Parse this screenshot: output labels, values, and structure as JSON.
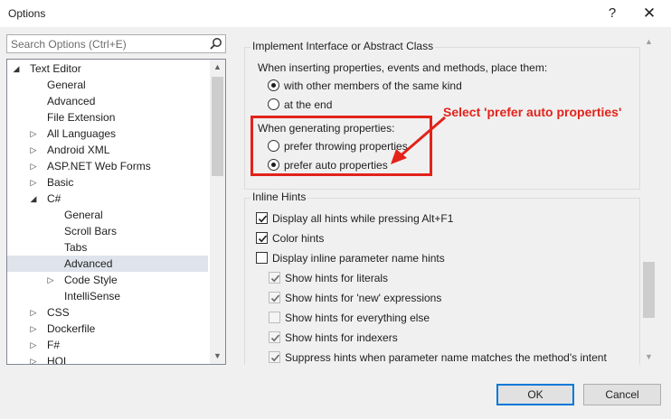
{
  "window": {
    "title": "Options",
    "help_glyph": "?",
    "close_glyph": "✕"
  },
  "search": {
    "placeholder": "Search Options (Ctrl+E)"
  },
  "tree": {
    "items": [
      {
        "label": "Text Editor",
        "caret": "◢"
      },
      {
        "label": "General",
        "caret": ""
      },
      {
        "label": "Advanced",
        "caret": ""
      },
      {
        "label": "File Extension",
        "caret": ""
      },
      {
        "label": "All Languages",
        "caret": "▷"
      },
      {
        "label": "Android XML",
        "caret": "▷"
      },
      {
        "label": "ASP.NET Web Forms",
        "caret": "▷"
      },
      {
        "label": "Basic",
        "caret": "▷"
      },
      {
        "label": "C#",
        "caret": "◢"
      },
      {
        "label": "General",
        "caret": ""
      },
      {
        "label": "Scroll Bars",
        "caret": ""
      },
      {
        "label": "Tabs",
        "caret": ""
      },
      {
        "label": "Advanced",
        "caret": "",
        "selected": true
      },
      {
        "label": "Code Style",
        "caret": "▷"
      },
      {
        "label": "IntelliSense",
        "caret": ""
      },
      {
        "label": "CSS",
        "caret": "▷"
      },
      {
        "label": "Dockerfile",
        "caret": "▷"
      },
      {
        "label": "F#",
        "caret": "▷"
      },
      {
        "label": "HQL",
        "caret": "▷"
      }
    ],
    "scroll_up": "▲",
    "scroll_down": "▼"
  },
  "implement_group": {
    "title": "Implement Interface or Abstract Class",
    "insert_label": "When inserting properties, events and methods, place them:",
    "insert_options": [
      {
        "label": "with other members of the same kind",
        "checked": true
      },
      {
        "label": "at the end",
        "checked": false
      }
    ],
    "generate_label": "When generating properties:",
    "generate_options": [
      {
        "label": "prefer throwing properties",
        "checked": false
      },
      {
        "label": "prefer auto properties",
        "checked": true
      }
    ]
  },
  "inline_hints": {
    "title": "Inline Hints",
    "options": [
      {
        "label": "Display all hints while pressing Alt+F1",
        "checked": true,
        "disabled": false
      },
      {
        "label": "Color hints",
        "checked": true,
        "disabled": false
      },
      {
        "label": "Display inline parameter name hints",
        "checked": false,
        "disabled": false
      },
      {
        "label": "Show hints for literals",
        "checked": true,
        "disabled": true
      },
      {
        "label": "Show hints for 'new' expressions",
        "checked": true,
        "disabled": true
      },
      {
        "label": "Show hints for everything else",
        "checked": false,
        "disabled": true
      },
      {
        "label": "Show hints for indexers",
        "checked": true,
        "disabled": true
      },
      {
        "label": "Suppress hints when parameter name matches the method's intent",
        "checked": true,
        "disabled": true
      }
    ]
  },
  "annotation": {
    "text": "Select 'prefer auto properties'",
    "color": "#e2231a"
  },
  "buttons": {
    "ok": "OK",
    "cancel": "Cancel"
  },
  "colors": {
    "accent": "#0078d7",
    "selection": "#dfe3eb"
  }
}
